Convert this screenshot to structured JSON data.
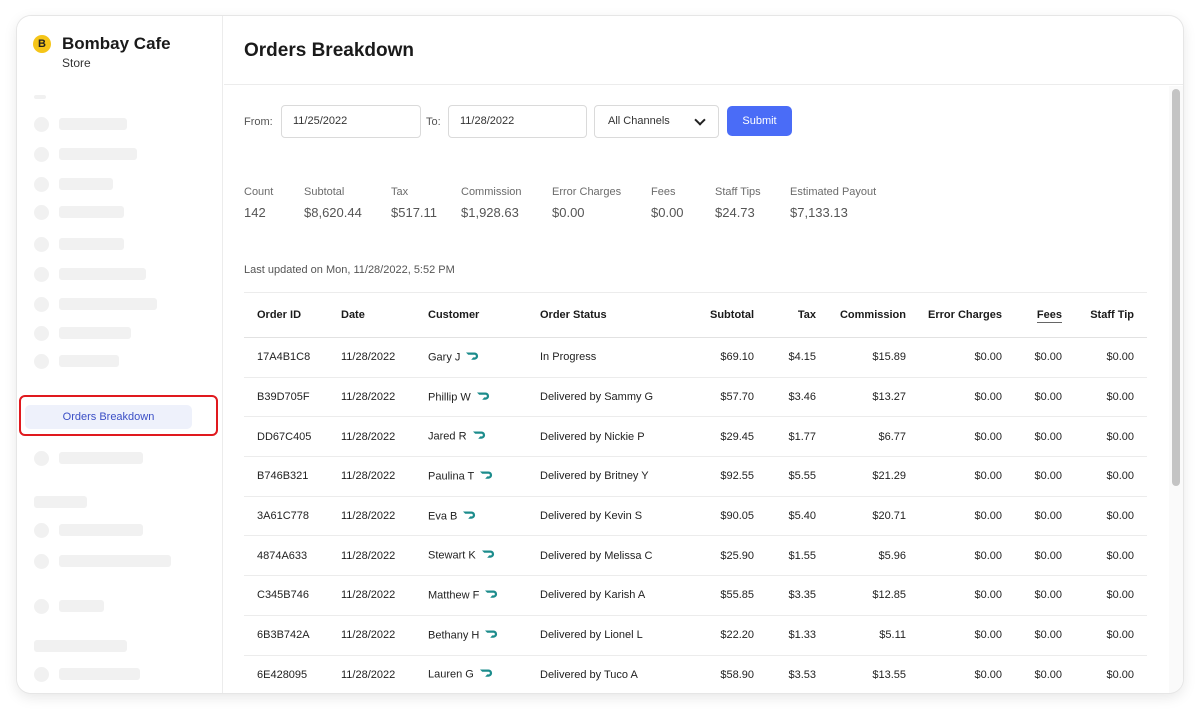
{
  "sidebar": {
    "store_badge": "B",
    "store_name": "Bombay Cafe",
    "store_sub": "Store",
    "active_item": "Orders Breakdown"
  },
  "header": {
    "title": "Orders Breakdown"
  },
  "filters": {
    "from_label": "From:",
    "from_value": "11/25/2022",
    "to_label": "To:",
    "to_value": "11/28/2022",
    "channel": "All Channels",
    "submit": "Submit"
  },
  "stats": [
    {
      "label": "Count",
      "value": "142"
    },
    {
      "label": "Subtotal",
      "value": "$8,620.44"
    },
    {
      "label": "Tax",
      "value": "$517.11"
    },
    {
      "label": "Commission",
      "value": "$1,928.63"
    },
    {
      "label": "Error Charges",
      "value": "$0.00"
    },
    {
      "label": "Fees",
      "value": "$0.00"
    },
    {
      "label": "Staff Tips",
      "value": "$24.73"
    },
    {
      "label": "Estimated Payout",
      "value": "$7,133.13"
    }
  ],
  "last_updated": "Last updated on Mon, 11/28/2022, 5:52 PM",
  "table": {
    "columns": [
      "Order ID",
      "Date",
      "Customer",
      "Order Status",
      "Subtotal",
      "Tax",
      "Commission",
      "Error Charges",
      "Fees",
      "Staff Tip"
    ],
    "rows": [
      {
        "id": "17A4B1C8",
        "date": "11/28/2022",
        "customer": "Gary J",
        "status": "In Progress",
        "subtotal": "$69.10",
        "tax": "$4.15",
        "commission": "$15.89",
        "error": "$0.00",
        "fees": "$0.00",
        "tip": "$0.00"
      },
      {
        "id": "B39D705F",
        "date": "11/28/2022",
        "customer": "Phillip W",
        "status": "Delivered by Sammy G",
        "subtotal": "$57.70",
        "tax": "$3.46",
        "commission": "$13.27",
        "error": "$0.00",
        "fees": "$0.00",
        "tip": "$0.00"
      },
      {
        "id": "DD67C405",
        "date": "11/28/2022",
        "customer": "Jared R",
        "status": "Delivered by Nickie P",
        "subtotal": "$29.45",
        "tax": "$1.77",
        "commission": "$6.77",
        "error": "$0.00",
        "fees": "$0.00",
        "tip": "$0.00"
      },
      {
        "id": "B746B321",
        "date": "11/28/2022",
        "customer": "Paulina T",
        "status": "Delivered by Britney Y",
        "subtotal": "$92.55",
        "tax": "$5.55",
        "commission": "$21.29",
        "error": "$0.00",
        "fees": "$0.00",
        "tip": "$0.00"
      },
      {
        "id": "3A61C778",
        "date": "11/28/2022",
        "customer": "Eva B",
        "status": "Delivered by Kevin S",
        "subtotal": "$90.05",
        "tax": "$5.40",
        "commission": "$20.71",
        "error": "$0.00",
        "fees": "$0.00",
        "tip": "$0.00"
      },
      {
        "id": "4874A633",
        "date": "11/28/2022",
        "customer": "Stewart K",
        "status": "Delivered by Melissa C",
        "subtotal": "$25.90",
        "tax": "$1.55",
        "commission": "$5.96",
        "error": "$0.00",
        "fees": "$0.00",
        "tip": "$0.00"
      },
      {
        "id": "C345B746",
        "date": "11/28/2022",
        "customer": "Matthew F",
        "status": "Delivered by Karish A",
        "subtotal": "$55.85",
        "tax": "$3.35",
        "commission": "$12.85",
        "error": "$0.00",
        "fees": "$0.00",
        "tip": "$0.00"
      },
      {
        "id": "6B3B742A",
        "date": "11/28/2022",
        "customer": "Bethany H",
        "status": "Delivered by Lionel L",
        "subtotal": "$22.20",
        "tax": "$1.33",
        "commission": "$5.11",
        "error": "$0.00",
        "fees": "$0.00",
        "tip": "$0.00"
      },
      {
        "id": "6E428095",
        "date": "11/28/2022",
        "customer": "Lauren G",
        "status": "Delivered by Tuco A",
        "subtotal": "$58.90",
        "tax": "$3.53",
        "commission": "$13.55",
        "error": "$0.00",
        "fees": "$0.00",
        "tip": "$0.00"
      }
    ]
  },
  "colors": {
    "accent": "#4a6cf7",
    "link": "#4a66c9",
    "highlight": "#e0191e",
    "dasher_icon": "#1c8c8c"
  },
  "icons": {
    "dasher": "dasher-icon",
    "dropdown": "chevron-down-icon"
  }
}
